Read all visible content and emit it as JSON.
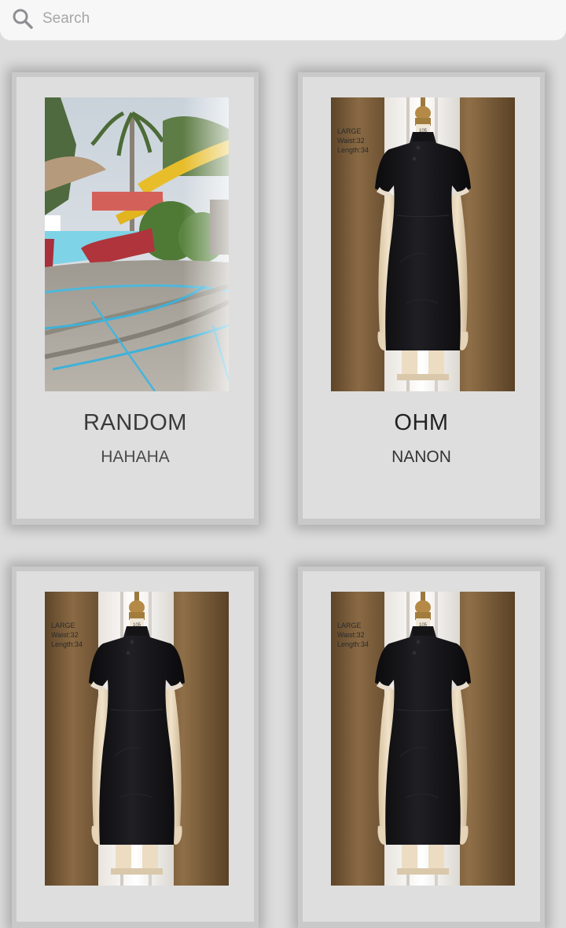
{
  "search": {
    "placeholder": "Search",
    "value": "",
    "icon": "search-icon"
  },
  "products": [
    {
      "title": "RANDOM",
      "subtitle": "HAHAHA",
      "image": "resort-pool-photo"
    },
    {
      "title": "OHM",
      "subtitle": "NANON",
      "image": "black-dress-mannequin-photo",
      "tag": [
        "LARGE",
        "Waist:32",
        "Length:34"
      ]
    },
    {
      "title": "",
      "subtitle": "",
      "image": "black-dress-mannequin-photo",
      "tag": [
        "LARGE",
        "Waist:32",
        "Length:34"
      ]
    },
    {
      "title": "",
      "subtitle": "",
      "image": "black-dress-mannequin-photo",
      "tag": [
        "LARGE",
        "Waist:32",
        "Length:34"
      ]
    }
  ],
  "colors": {
    "background": "#dcdcdc",
    "card": "#dedede",
    "card_border": "#c9c9c9",
    "search_bar": "#f7f7f7",
    "placeholder": "#a6a6a6"
  }
}
